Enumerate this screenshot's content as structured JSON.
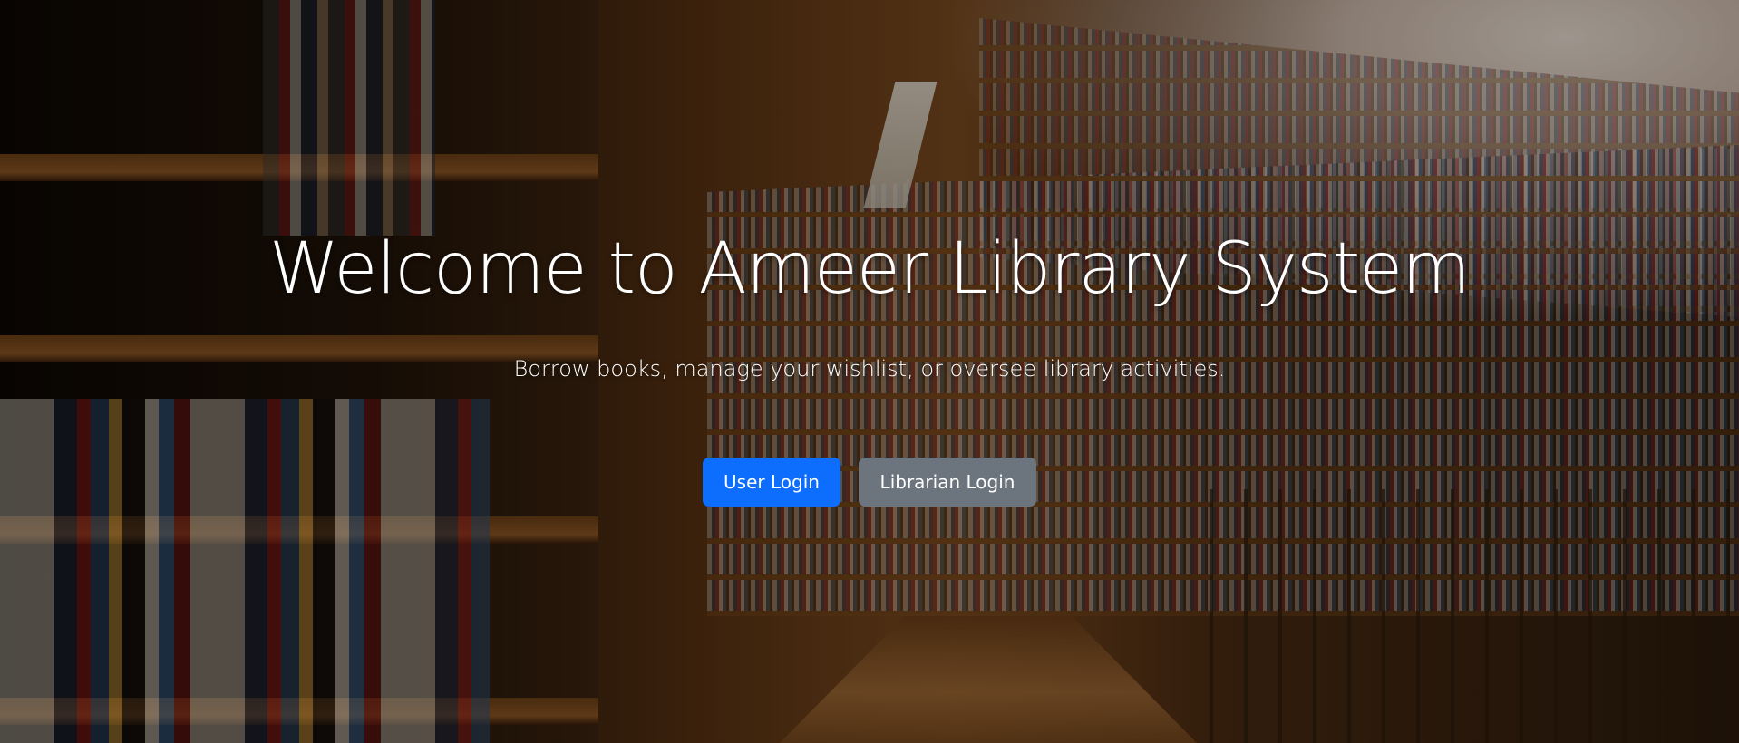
{
  "hero": {
    "background_image": "library-bookshelves-photo",
    "title": "Welcome to Ameer Library System",
    "subtitle": "Borrow books, manage your wishlist, or oversee library activities.",
    "buttons": {
      "user_login": "User Login",
      "librarian_login": "Librarian Login"
    }
  },
  "colors": {
    "primary_button": "#0d6efd",
    "secondary_button": "#6c757d",
    "text": "#ffffff"
  }
}
